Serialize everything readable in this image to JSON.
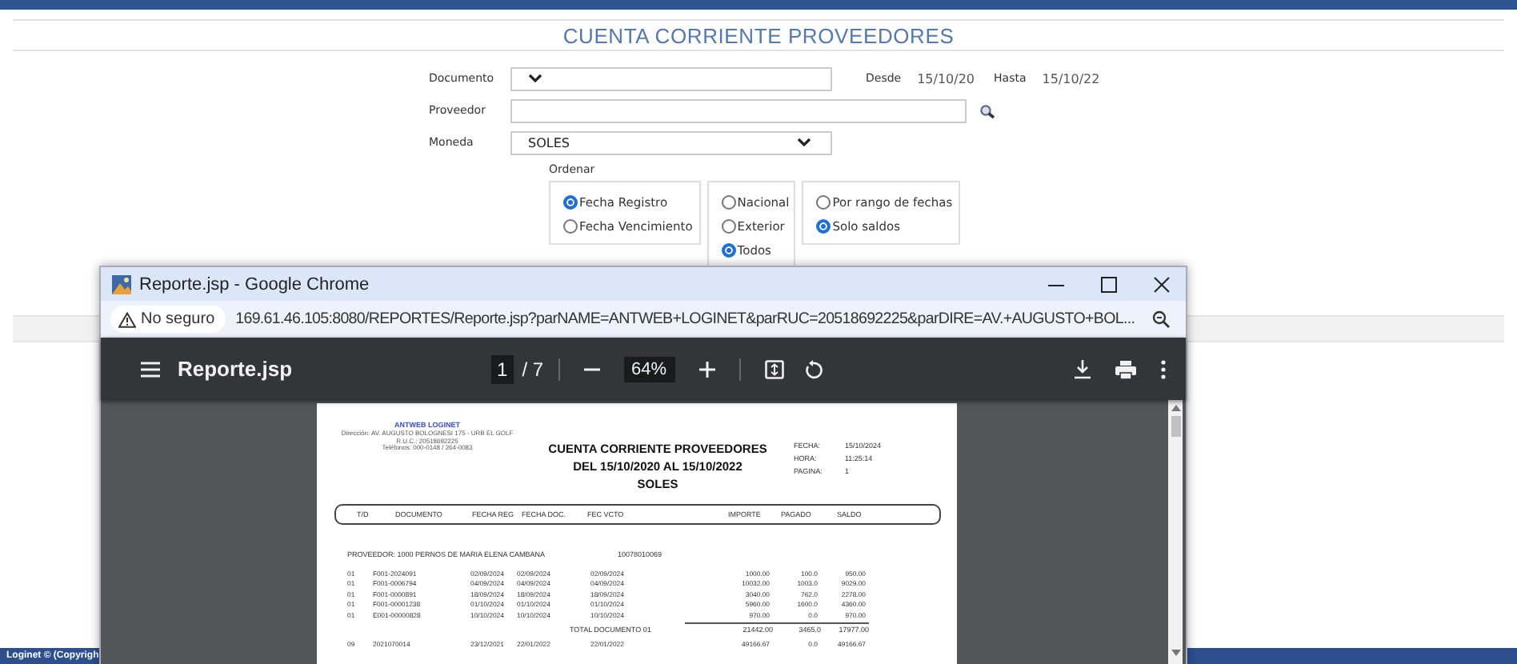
{
  "header": {
    "title": "CUENTA CORRIENTE PROVEEDORES"
  },
  "filters": {
    "documento": {
      "label": "Documento",
      "kind": "select"
    },
    "desde": {
      "label": "Desde",
      "value": "15/10/20"
    },
    "hasta": {
      "label": "Hasta",
      "value": "15/10/22"
    },
    "proveedor": {
      "label": "Proveedor",
      "kind": "text"
    },
    "moneda": {
      "label": "Moneda",
      "kind": "select",
      "value": "SOLES"
    }
  },
  "ordenar": {
    "label": "Ordenar",
    "groups": [
      {
        "options": [
          {
            "label": "Fecha Registro",
            "selected": true
          },
          {
            "label": "Fecha Vencimiento",
            "selected": false
          }
        ]
      },
      {
        "options": [
          {
            "label": "Nacional",
            "selected": false
          },
          {
            "label": "Exterior",
            "selected": false
          },
          {
            "label": "Todos",
            "selected": true
          }
        ]
      },
      {
        "options": [
          {
            "label": "Por rango de fechas",
            "selected": false
          },
          {
            "label": "Solo saldos",
            "selected": true
          }
        ]
      }
    ]
  },
  "popup": {
    "title": "Reporte.jsp - Google Chrome",
    "security": "No seguro",
    "url": "169.61.46.105:8080/REPORTES/Reporte.jsp?parNAME=ANTWEB+LOGINET&parRUC=20518692225&parDIRE=AV.+AUGUSTO+BOL...",
    "viewer": {
      "filename": "Reporte.jsp",
      "page": "1",
      "page_count": "/ 7",
      "zoom": "64%"
    },
    "report": {
      "company": "ANTWEB LOGINET",
      "company_lines": [
        "Dirección: AV. AUGUSTO BOLOGNESI 175 - URB EL GOLF",
        "R.U.C.: 20518692225",
        "Teléfonos: 000-0148 / 264-0083"
      ],
      "title_lines": [
        "CUENTA CORRIENTE PROVEEDORES",
        "DEL 15/10/2020 AL 15/10/2022",
        "SOLES"
      ],
      "meta": [
        {
          "label": "FECHA:",
          "value": "15/10/2024"
        },
        {
          "label": "HORA:",
          "value": "11:25:14"
        },
        {
          "label": "PAGINA:",
          "value": "1"
        }
      ],
      "columns": [
        "T/D",
        "DOCUMENTO",
        "FECHA REG",
        "FECHA DOC.",
        "FEC VCTO",
        "IMPORTE",
        "PAGADO",
        "SALDO"
      ],
      "provider": {
        "name": "PROVEEDOR: 1000 PERNOS DE MARIA ELENA CAMBANA",
        "ruc": "10078010069"
      },
      "rows": [
        [
          "01",
          "F001-2024091",
          "02/09/2024",
          "02/09/2024",
          "02/09/2024",
          "1000.00",
          "100.0",
          "950.00"
        ],
        [
          "01",
          "F001-0006794",
          "04/09/2024",
          "04/09/2024",
          "04/09/2024",
          "10032.00",
          "1003.0",
          "9029.00"
        ],
        [
          "01",
          "F001-0000891",
          "18/09/2024",
          "18/09/2024",
          "18/09/2024",
          "3040.00",
          "762.0",
          "2278.00"
        ],
        [
          "01",
          "F001-00001238",
          "01/10/2024",
          "01/10/2024",
          "01/10/2024",
          "5960.00",
          "1600.0",
          "4360.00"
        ],
        [
          "01",
          "E001-00000828",
          "10/10/2024",
          "10/10/2024",
          "10/10/2024",
          "970.00",
          "0.0",
          "970.00"
        ]
      ],
      "total": {
        "label": "TOTAL DOCUMENTO 01",
        "values": [
          "21442.00",
          "3465.0",
          "17977.00"
        ]
      },
      "next_rows": [
        [
          "09",
          "2021070014",
          "23/12/2021",
          "22/01/2022",
          "22/01/2022",
          "49166.67",
          "0.0",
          "49166.67"
        ]
      ]
    }
  },
  "footer": {
    "text": "Loginet © (Copyrigh"
  }
}
